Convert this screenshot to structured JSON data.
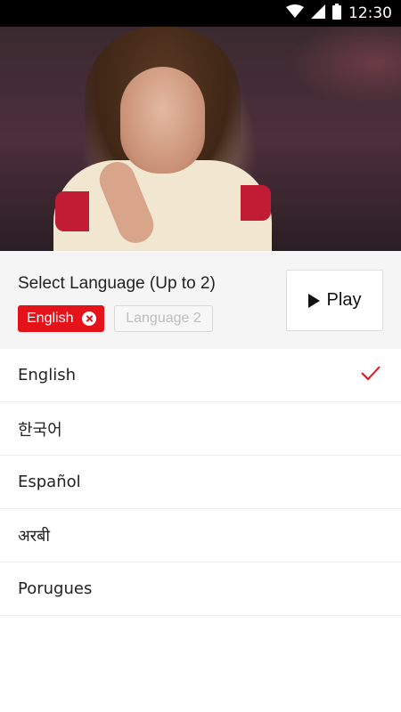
{
  "status_bar": {
    "time": "12:30",
    "icons": [
      "wifi-icon",
      "signal-icon",
      "battery-icon"
    ]
  },
  "video": {
    "description_icon": "video-thumbnail"
  },
  "language_selector": {
    "title": "Select Language (Up to 2)",
    "selected_chip": "English",
    "empty_chip": "Language 2",
    "play_label": "Play"
  },
  "languages": [
    {
      "label": "English",
      "selected": true
    },
    {
      "label": "한국어",
      "selected": false
    },
    {
      "label": "Español",
      "selected": false
    },
    {
      "label": "अरबी",
      "selected": false
    },
    {
      "label": "Porugues",
      "selected": false
    }
  ],
  "colors": {
    "accent": "#e5121a",
    "header_bg": "#f5f5f5",
    "divider": "#ececec"
  }
}
